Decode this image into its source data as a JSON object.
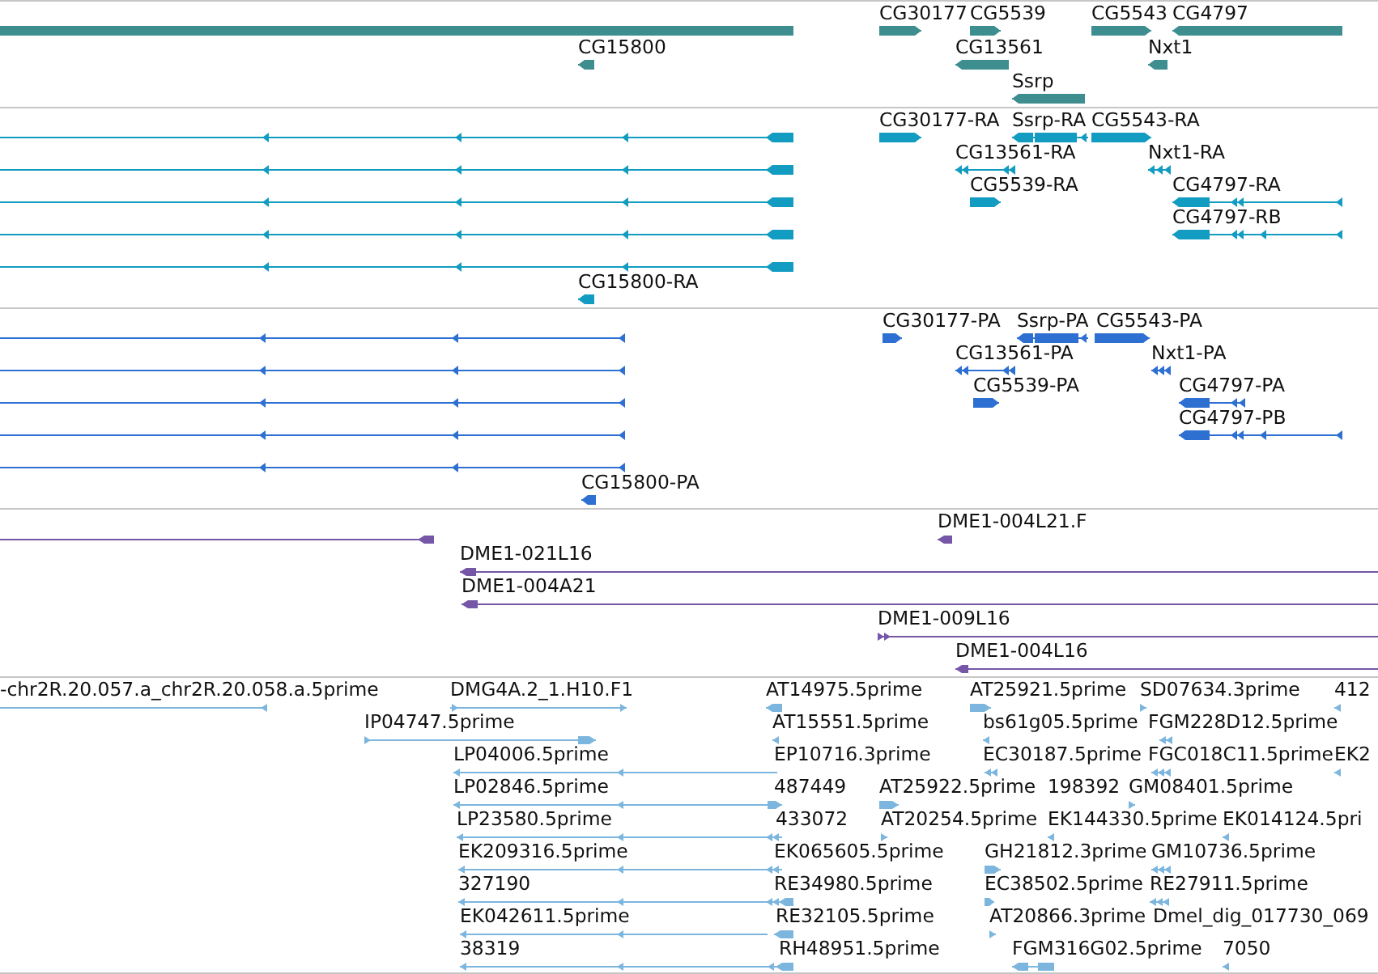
{
  "tracks": [
    {
      "kind": "gene",
      "color": "#3f8e8f",
      "features": [
        {
          "left_arrow": false,
          "right_arrow": false
        },
        {
          "label": "CG30177",
          "left_arrow": false,
          "right_arrow": true
        },
        {
          "label": "CG5539",
          "left_arrow": false,
          "right_arrow": true
        },
        {
          "label": "CG5543",
          "left_arrow": false,
          "right_arrow": true
        },
        {
          "label": "CG4797",
          "left_arrow": true,
          "right_arrow": false
        },
        {
          "label": "CG15800",
          "left_arrow": true,
          "right_arrow": false
        },
        {
          "label": "CG13561",
          "left_arrow": true,
          "right_arrow": false
        },
        {
          "label": "Nxt1",
          "left_arrow": true,
          "right_arrow": false
        },
        {
          "label": "Ssrp",
          "left_arrow": true,
          "right_arrow": false
        }
      ]
    },
    {
      "kind": "transcript",
      "color": "#129cc1",
      "features": [
        {
          "left_arrow": true,
          "right_arrow": false
        },
        {
          "left_arrow": true,
          "right_arrow": false
        },
        {
          "left_arrow": true,
          "right_arrow": false
        },
        {
          "left_arrow": true,
          "right_arrow": false
        },
        {
          "left_arrow": true,
          "right_arrow": false
        },
        {
          "label": "CG30177-RA",
          "left_arrow": false,
          "right_arrow": true
        },
        {
          "label": "Ssrp-RA",
          "left_arrow": true,
          "right_arrow": false
        },
        {
          "label": "CG5543-RA",
          "left_arrow": false,
          "right_arrow": true
        },
        {
          "label": "CG13561-RA",
          "left_arrow": true,
          "right_arrow": false
        },
        {
          "label": "Nxt1-RA",
          "left_arrow": true,
          "right_arrow": false
        },
        {
          "label": "CG5539-RA",
          "left_arrow": false,
          "right_arrow": true
        },
        {
          "label": "CG4797-RA",
          "left_arrow": true,
          "right_arrow": false
        },
        {
          "label": "CG4797-RB",
          "left_arrow": true,
          "right_arrow": false
        },
        {
          "label": "CG15800-RA",
          "left_arrow": true,
          "right_arrow": false
        }
      ]
    },
    {
      "kind": "transcript",
      "color": "#2e6fd2",
      "features": [
        {
          "left_arrow": true,
          "right_arrow": false
        },
        {
          "left_arrow": true,
          "right_arrow": false
        },
        {
          "left_arrow": true,
          "right_arrow": false
        },
        {
          "left_arrow": true,
          "right_arrow": false
        },
        {
          "left_arrow": true,
          "right_arrow": false
        },
        {
          "label": "CG30177-PA",
          "left_arrow": false,
          "right_arrow": true
        },
        {
          "label": "Ssrp-PA",
          "left_arrow": true,
          "right_arrow": false
        },
        {
          "label": "CG5543-PA",
          "left_arrow": false,
          "right_arrow": true
        },
        {
          "label": "CG13561-PA",
          "left_arrow": true,
          "right_arrow": false
        },
        {
          "label": "Nxt1-PA",
          "left_arrow": true,
          "right_arrow": false
        },
        {
          "label": "CG5539-PA",
          "left_arrow": false,
          "right_arrow": true
        },
        {
          "label": "CG4797-PA",
          "left_arrow": true,
          "right_arrow": false
        },
        {
          "label": "CG4797-PB",
          "left_arrow": true,
          "right_arrow": false
        },
        {
          "label": "CG15800-PA",
          "left_arrow": true,
          "right_arrow": false
        }
      ]
    },
    {
      "kind": "clone",
      "color": "#7556a7",
      "features": [
        {
          "left_arrow": true,
          "right_arrow": false
        },
        {
          "label": "DME1-004L21.F",
          "left_arrow": true,
          "right_arrow": false
        },
        {
          "label": "DME1-021L16",
          "left_arrow": true,
          "right_arrow": false
        },
        {
          "label": "DME1-004A21",
          "left_arrow": true,
          "right_arrow": false
        },
        {
          "label": "DME1-009L16",
          "left_arrow": false,
          "right_arrow": true
        },
        {
          "label": "DME1-004L16",
          "left_arrow": true,
          "right_arrow": false
        }
      ]
    },
    {
      "kind": "read",
      "color": "#7cb6de",
      "features": [
        {
          "label": "-chr2R.20.057.a_chr2R.20.058.a.5prime",
          "left_arrow": true,
          "right_arrow": false
        },
        {
          "label": "DMG4A.2_1.H10.F1",
          "left_arrow": false,
          "right_arrow": true
        },
        {
          "label": "AT14975.5prime",
          "left_arrow": true,
          "right_arrow": false
        },
        {
          "label": "AT25921.5prime",
          "left_arrow": false,
          "right_arrow": true
        },
        {
          "label": "SD07634.3prime",
          "left_arrow": false,
          "right_arrow": true
        },
        {
          "label": "412",
          "left_arrow": true,
          "right_arrow": false
        },
        {
          "label": "IP04747.5prime",
          "left_arrow": false,
          "right_arrow": true
        },
        {
          "label": "AT15551.5prime",
          "left_arrow": true,
          "right_arrow": false
        },
        {
          "label": "bs61g05.5prime",
          "left_arrow": true,
          "right_arrow": false
        },
        {
          "label": "FGM228D12.5prime",
          "left_arrow": true,
          "right_arrow": false
        },
        {
          "label": "LP04006.5prime",
          "left_arrow": true,
          "right_arrow": false
        },
        {
          "label": "EP10716.3prime"
        },
        {
          "label": "EC30187.5prime",
          "left_arrow": true,
          "right_arrow": false
        },
        {
          "label": "FGC018C11.5prime",
          "left_arrow": true,
          "right_arrow": false
        },
        {
          "label": "EK2",
          "left_arrow": true,
          "right_arrow": false
        },
        {
          "label": "LP02846.5prime",
          "left_arrow": true,
          "right_arrow": false
        },
        {
          "label": "487449",
          "left_arrow": false,
          "right_arrow": true
        },
        {
          "label": "AT25922.5prime",
          "left_arrow": false,
          "right_arrow": true
        },
        {
          "label": "198392"
        },
        {
          "label": "GM08401.5prime",
          "left_arrow": false,
          "right_arrow": true
        },
        {
          "label": "LP23580.5prime",
          "left_arrow": true,
          "right_arrow": false
        },
        {
          "label": "433072",
          "left_arrow": true,
          "right_arrow": false
        },
        {
          "label": "AT20254.5prime",
          "left_arrow": false,
          "right_arrow": true
        },
        {
          "label": "EK144330.5prime",
          "left_arrow": true,
          "right_arrow": false
        },
        {
          "label": "EK014124.5pri",
          "left_arrow": true,
          "right_arrow": false
        },
        {
          "label": "EK209316.5prime",
          "left_arrow": true,
          "right_arrow": false
        },
        {
          "label": "EK065605.5prime",
          "left_arrow": true,
          "right_arrow": false
        },
        {
          "label": "GH21812.3prime",
          "left_arrow": false,
          "right_arrow": true
        },
        {
          "label": "GM10736.5prime",
          "left_arrow": true,
          "right_arrow": false
        },
        {
          "label": "327190",
          "left_arrow": true,
          "right_arrow": false
        },
        {
          "label": "RE34980.5prime",
          "left_arrow": true,
          "right_arrow": false
        },
        {
          "label": "EC38502.5prime",
          "left_arrow": false,
          "right_arrow": true
        },
        {
          "label": "RE27911.5prime",
          "left_arrow": true,
          "right_arrow": false
        },
        {
          "label": "EK042611.5prime",
          "left_arrow": true,
          "right_arrow": false
        },
        {
          "label": "RE32105.5prime",
          "left_arrow": true,
          "right_arrow": false
        },
        {
          "label": "AT20866.3prime",
          "left_arrow": false,
          "right_arrow": true
        },
        {
          "label": "Dmel_dig_017730_069"
        },
        {
          "label": "38319",
          "left_arrow": true,
          "right_arrow": false
        },
        {
          "label": "RH48951.5prime",
          "left_arrow": true,
          "right_arrow": false
        },
        {
          "label": "FGM316G02.5prime",
          "left_arrow": true,
          "right_arrow": false
        },
        {
          "label": "7050",
          "left_arrow": true,
          "right_arrow": false
        }
      ]
    }
  ]
}
